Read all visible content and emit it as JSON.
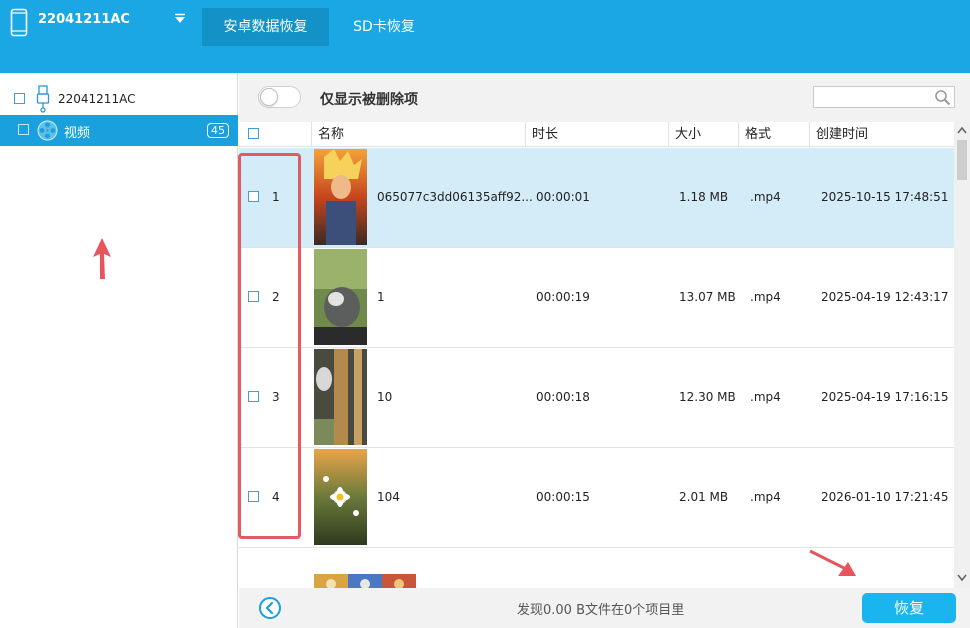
{
  "header": {
    "device_name": "22041211AC",
    "tabs": [
      {
        "label": "安卓数据恢复",
        "active": true
      },
      {
        "label": "SD卡恢复",
        "active": false
      }
    ]
  },
  "sidebar": {
    "device_label": "22041211AC",
    "video_label": "视频",
    "video_count": "45"
  },
  "filter": {
    "toggle_label": "仅显示被删除项",
    "toggle_on": false,
    "search_value": ""
  },
  "table": {
    "columns": [
      "名称",
      "时长",
      "大小",
      "格式",
      "创建时间"
    ],
    "rows": [
      {
        "index": "1",
        "name": "065077c3dd06135aff92...",
        "duration": "00:00:01",
        "size": "1.18 MB",
        "format": ".mp4",
        "created": "2025-10-15 17:48:51",
        "selected": true
      },
      {
        "index": "2",
        "name": "1",
        "duration": "00:00:19",
        "size": "13.07 MB",
        "format": ".mp4",
        "created": "2025-04-19 12:43:17",
        "selected": false
      },
      {
        "index": "3",
        "name": "10",
        "duration": "00:00:18",
        "size": "12.30 MB",
        "format": ".mp4",
        "created": "2025-04-19 17:16:15",
        "selected": false
      },
      {
        "index": "4",
        "name": "104",
        "duration": "00:00:15",
        "size": "2.01 MB",
        "format": ".mp4",
        "created": "2026-01-10 17:21:45",
        "selected": false
      }
    ]
  },
  "footer": {
    "status": "发现0.00 B文件在0个项目里",
    "recover_label": "恢复"
  },
  "colors": {
    "header_bg": "#1aa7e4",
    "active_tab": "#1392c8",
    "selected_sidebar": "#1aa0dc",
    "selected_row": "#d3ecf7",
    "recover_button": "#1ab5ef",
    "annotation_red": "#e05b63"
  },
  "icons": [
    "phone-icon",
    "dropdown-arrow-icon",
    "usb-icon",
    "film-reel-icon",
    "search-icon",
    "back-icon",
    "scroll-up-icon",
    "scroll-down-icon"
  ]
}
